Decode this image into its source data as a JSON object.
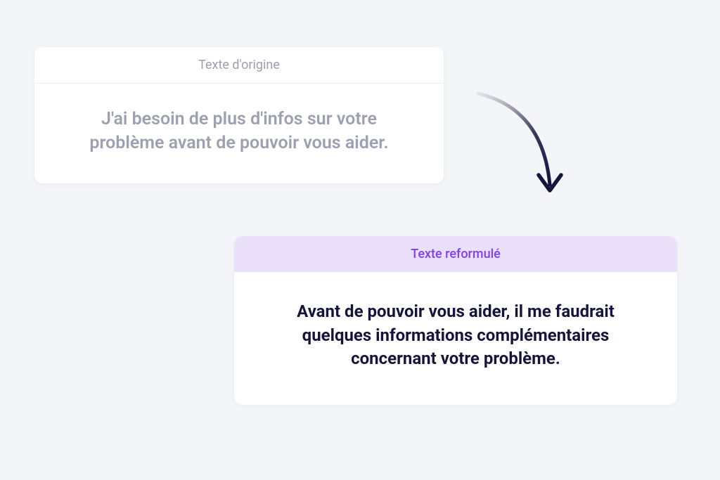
{
  "original": {
    "header": "Texte d'origine",
    "content": "J'ai besoin de plus d'infos sur votre problème avant de pouvoir vous aider."
  },
  "rephrased": {
    "header": "Texte reformulé",
    "content": "Avant de pouvoir vous aider, il me faudrait quelques informations complémentaires concernant votre problème."
  }
}
